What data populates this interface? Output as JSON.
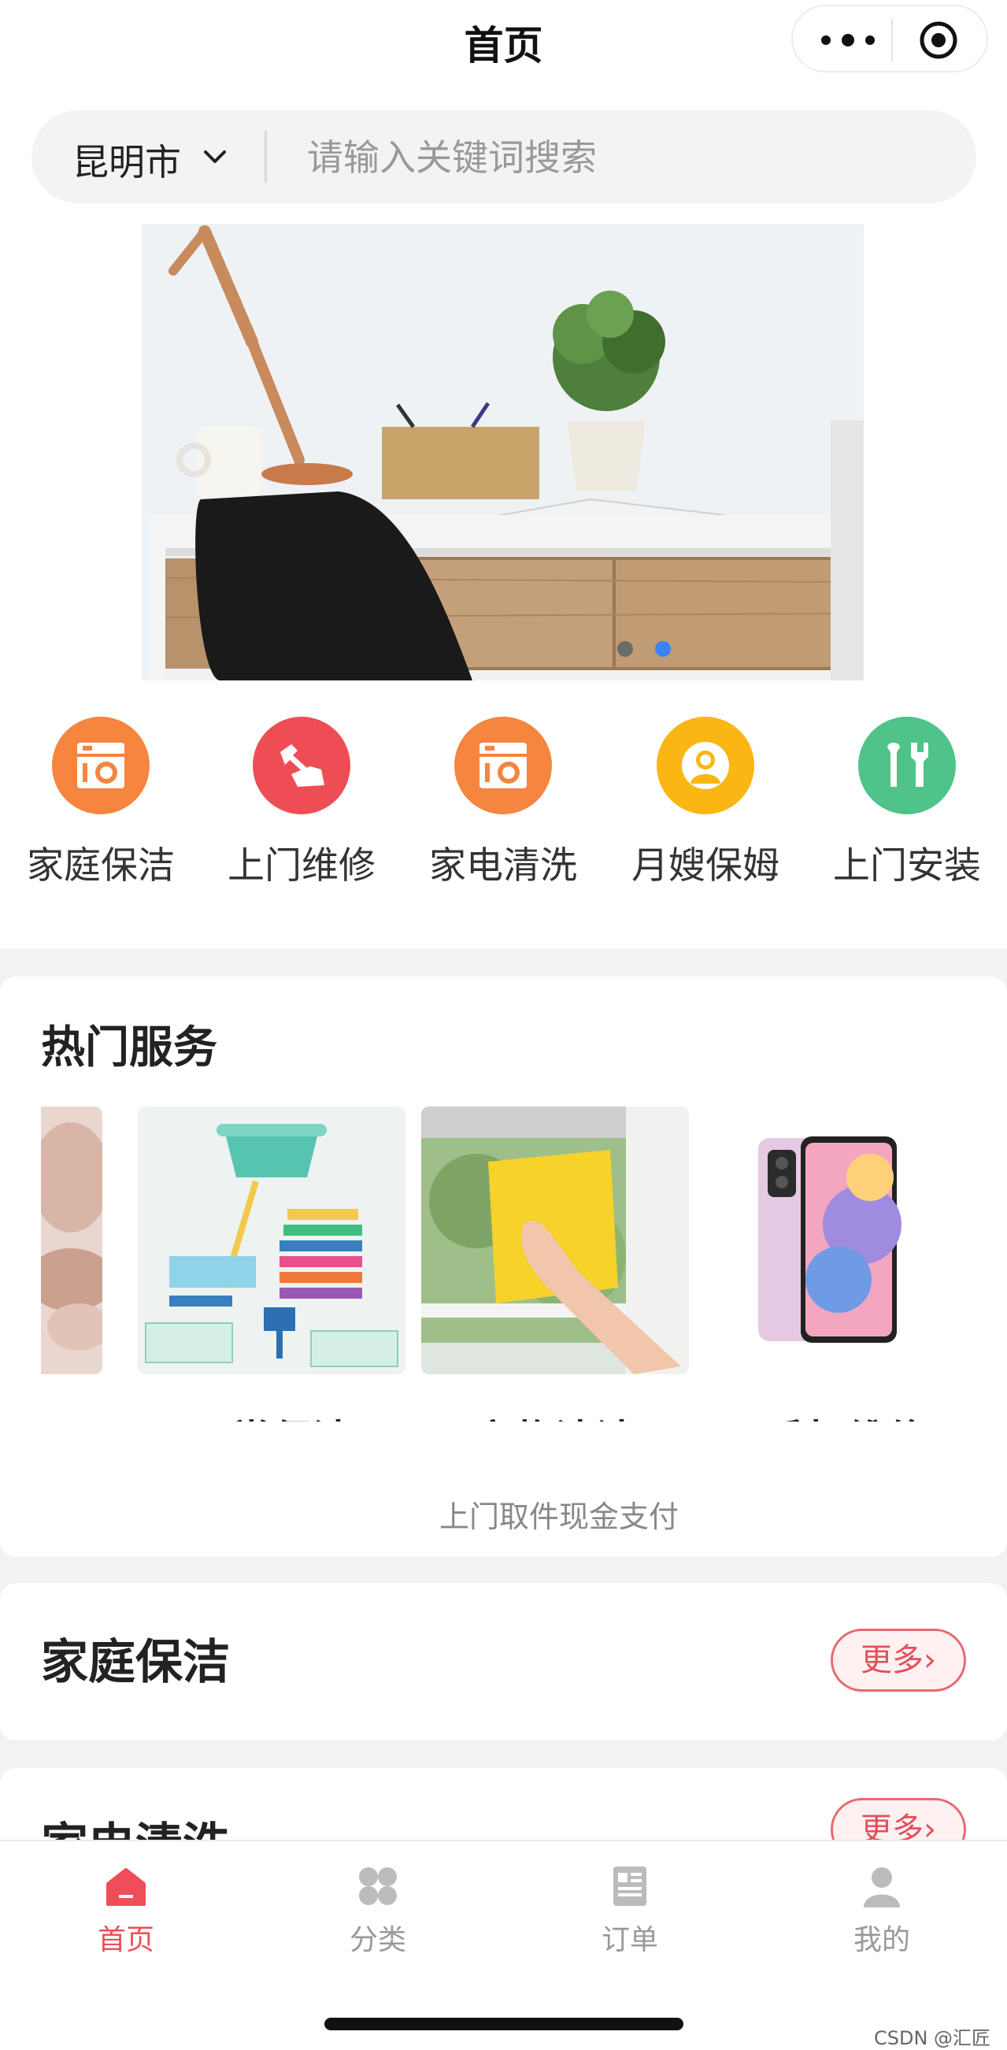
{
  "nav": {
    "title": "首页"
  },
  "search": {
    "city": "昆明市",
    "placeholder": "请输入关键词搜索"
  },
  "banner": {
    "slides": 2,
    "active_slide": 2
  },
  "categories": [
    {
      "label": "家庭保洁",
      "icon": "washing-machine-icon",
      "color": "#f5853f"
    },
    {
      "label": "上门维修",
      "icon": "wrench-hand-icon",
      "color": "#ef4d55"
    },
    {
      "label": "家电清洗",
      "icon": "washing-machine-icon",
      "color": "#f5853f"
    },
    {
      "label": "月嫂保姆",
      "icon": "nanny-icon",
      "color": "#fbb614"
    },
    {
      "label": "上门安装",
      "icon": "tools-icon",
      "color": "#4fc38a"
    }
  ],
  "hot": {
    "title": "热门服务",
    "items": [
      {
        "name": "日常保洁"
      },
      {
        "name": "衣物清洁"
      },
      {
        "name": "手机维修"
      }
    ],
    "subtitle": "上门取件现金支付"
  },
  "sections": [
    {
      "title": "家庭保洁",
      "more": "更多›"
    },
    {
      "title": "家电清洗",
      "more": "更多›"
    }
  ],
  "tabbar": [
    {
      "label": "首页",
      "active": true
    },
    {
      "label": "分类",
      "active": false
    },
    {
      "label": "订单",
      "active": false
    },
    {
      "label": "我的",
      "active": false
    }
  ],
  "watermark": "CSDN @汇匠源"
}
